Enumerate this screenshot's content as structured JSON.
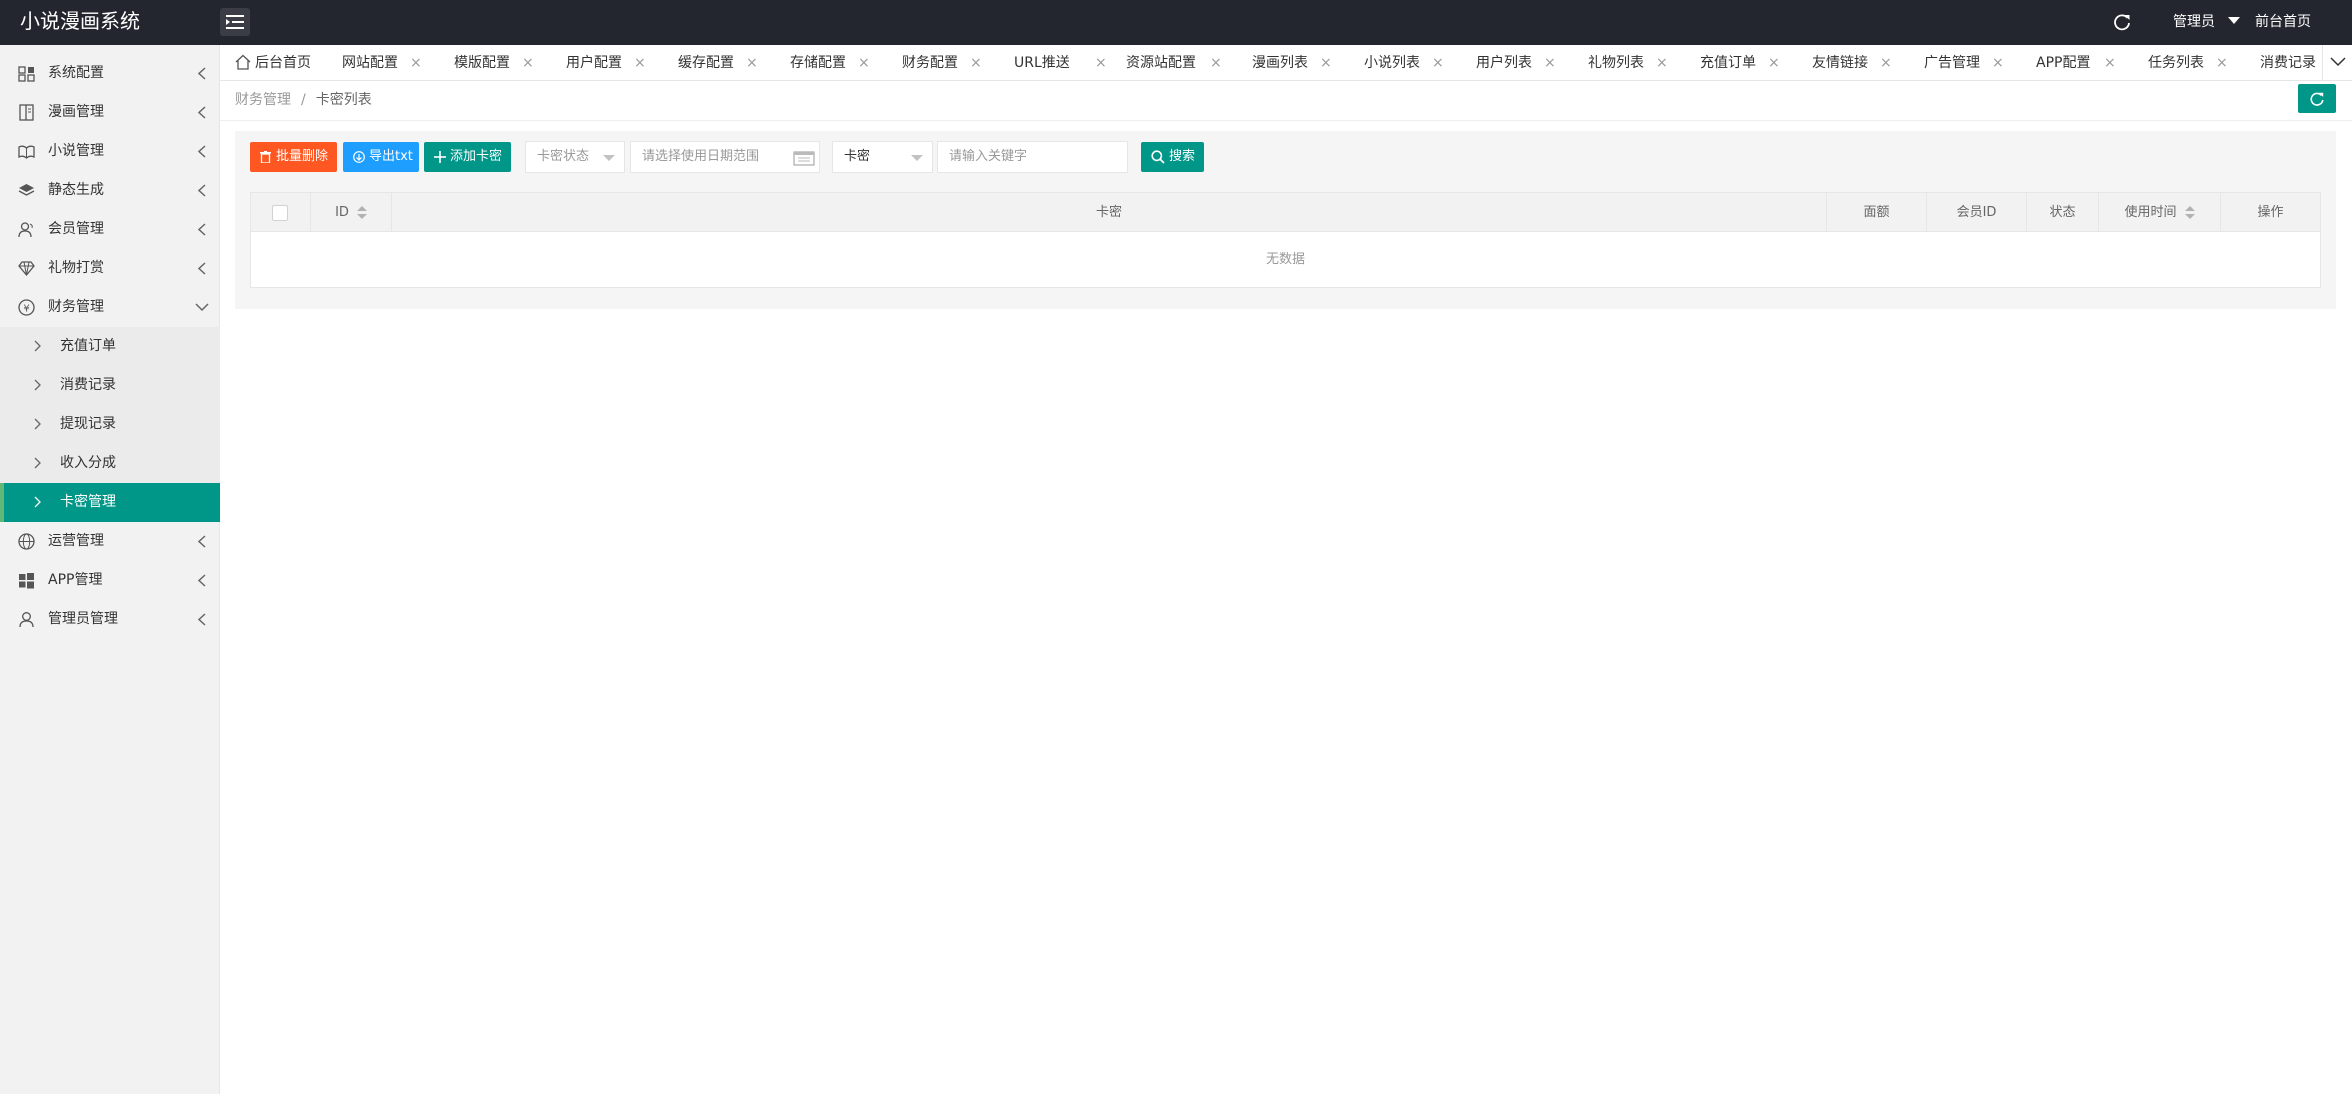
{
  "header": {
    "logo": "小说漫画系统",
    "admin_label": "管理员",
    "home_link": "前台首页"
  },
  "sidebar": {
    "items": [
      {
        "label": "系统配置",
        "icon": "settings-icon"
      },
      {
        "label": "漫画管理",
        "icon": "book-icon"
      },
      {
        "label": "小说管理",
        "icon": "read-icon"
      },
      {
        "label": "静态生成",
        "icon": "layers-icon"
      },
      {
        "label": "会员管理",
        "icon": "users-icon"
      },
      {
        "label": "礼物打赏",
        "icon": "diamond-icon"
      },
      {
        "label": "财务管理",
        "icon": "yen-icon"
      }
    ],
    "finance_sub": [
      {
        "label": "充值订单"
      },
      {
        "label": "消费记录"
      },
      {
        "label": "提现记录"
      },
      {
        "label": "收入分成"
      },
      {
        "label": "卡密管理"
      }
    ],
    "items_after": [
      {
        "label": "运营管理",
        "icon": "globe-icon"
      },
      {
        "label": "APP管理",
        "icon": "windows-icon"
      },
      {
        "label": "管理员管理",
        "icon": "user-icon"
      }
    ]
  },
  "tabs": [
    {
      "label": "后台首页"
    },
    {
      "label": "网站配置"
    },
    {
      "label": "模版配置"
    },
    {
      "label": "用户配置"
    },
    {
      "label": "缓存配置"
    },
    {
      "label": "存储配置"
    },
    {
      "label": "财务配置"
    },
    {
      "label": "URL推送"
    },
    {
      "label": "资源站配置"
    },
    {
      "label": "漫画列表"
    },
    {
      "label": "小说列表"
    },
    {
      "label": "用户列表"
    },
    {
      "label": "礼物列表"
    },
    {
      "label": "充值订单"
    },
    {
      "label": "友情链接"
    },
    {
      "label": "广告管理"
    },
    {
      "label": "APP配置"
    },
    {
      "label": "任务列表"
    },
    {
      "label": "消费记录"
    }
  ],
  "breadcrumb": {
    "parent": "财务管理",
    "separator": "/",
    "current": "卡密列表"
  },
  "toolbar": {
    "batch_delete": "批量删除",
    "export": "导出txt",
    "add": "添加卡密",
    "status_placeholder": "卡密状态",
    "date_placeholder": "请选择使用日期范围",
    "type_value": "卡密",
    "keyword_placeholder": "请输入关键字",
    "search": "搜索"
  },
  "table": {
    "columns": [
      "ID",
      "卡密",
      "面额",
      "会员ID",
      "状态",
      "使用时间",
      "操作"
    ],
    "empty_text": "无数据"
  },
  "colors": {
    "header_bg": "#23262e",
    "accent": "#009688",
    "danger": "#ff5722",
    "info": "#1e9fff"
  }
}
